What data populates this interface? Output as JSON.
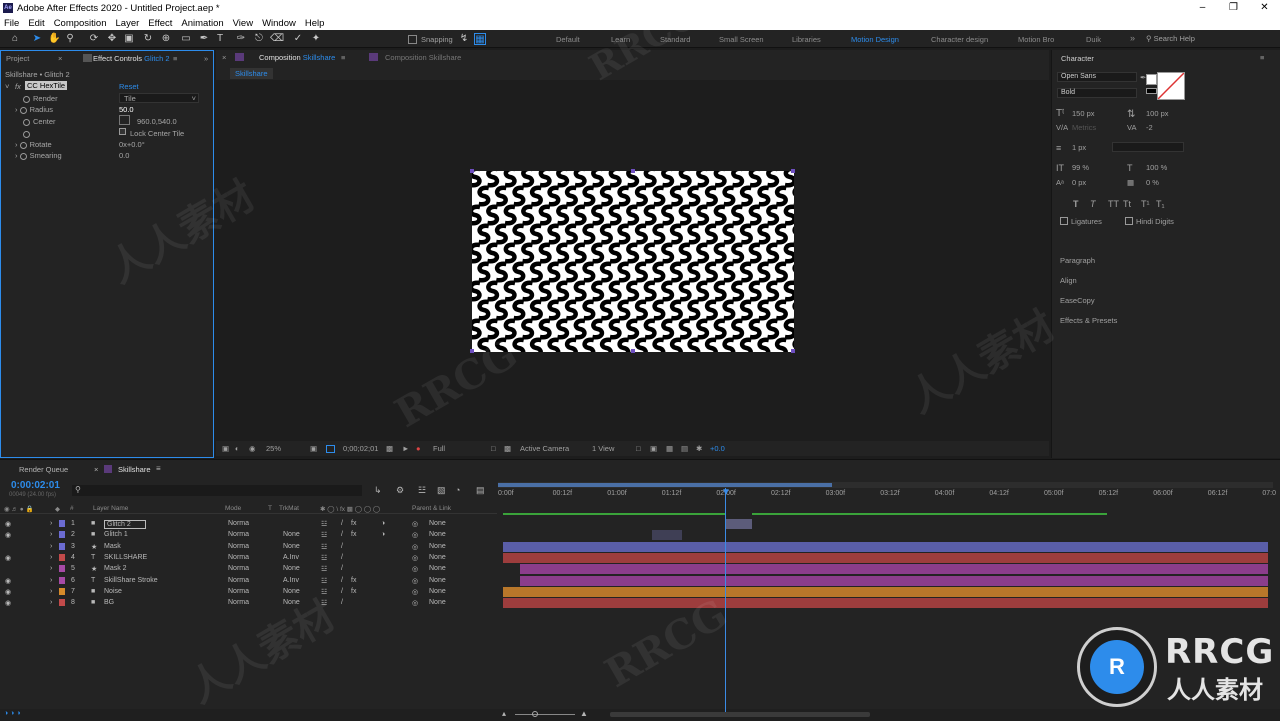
{
  "window": {
    "title": "Adobe After Effects 2020 - Untitled Project.aep *",
    "app_icon": "Ae"
  },
  "menu": [
    "File",
    "Edit",
    "Composition",
    "Layer",
    "Effect",
    "Animation",
    "View",
    "Window",
    "Help"
  ],
  "toolbar": {
    "snapping_label": "Snapping"
  },
  "workspaces": [
    "Default",
    "Learn",
    "Standard",
    "Small Screen",
    "Libraries",
    "Motion Design",
    "Character design",
    "Motion Bro",
    "Duik"
  ],
  "active_workspace": "Motion Design",
  "search_help": "Search Help",
  "effect_controls": {
    "tab_project": "Project",
    "tab_label": "Effect Controls",
    "tab_layer": "Glitch 2",
    "header": "Skillshare • Glitch 2",
    "fx_badge": "fx",
    "effect_name": "CC HexTile",
    "reset": "Reset",
    "props": [
      {
        "name": "Render",
        "value": "Tile"
      },
      {
        "name": "Radius",
        "value": "50.0"
      },
      {
        "name": "Center",
        "value": "960.0,540.0"
      },
      {
        "name": "",
        "value": "Lock Center Tile"
      },
      {
        "name": "Rotate",
        "value": "0x+0.0°"
      },
      {
        "name": "Smearing",
        "value": "0.0"
      }
    ]
  },
  "composition": {
    "tab_prefix": "Composition",
    "tab_name": "Skillshare",
    "tab2": "Composition Skillshare",
    "breadcrumb": "Skillshare"
  },
  "viewer_bar": {
    "zoom": "25%",
    "timecode": "0;00;02;01",
    "resolution": "Full",
    "camera": "Active Camera",
    "views": "1 View",
    "exposure": "+0.0"
  },
  "character": {
    "title": "Character",
    "font": "Open Sans",
    "style": "Bold",
    "size": "150 px",
    "leading": "100 px",
    "kerning": "Metrics",
    "tracking": "-2",
    "stroke": "1 px",
    "v_scale": "99 %",
    "h_scale": "100 %",
    "baseline": "0 px",
    "tsume": "0 %",
    "style_buttons": [
      "T",
      "T",
      "TT",
      "Tt",
      "T¹",
      "T₁"
    ],
    "ligatures": "Ligatures",
    "hindi_digits": "Hindi Digits",
    "sections": [
      "Paragraph",
      "Align",
      "EaseCopy",
      "Effects & Presets"
    ]
  },
  "timeline": {
    "tab_render": "Render Queue",
    "tab_comp": "Skillshare",
    "timecode": "0:00:02:01",
    "frame_info": "00049 (24.00 fps)",
    "col_layer_name": "Layer Name",
    "col_mode": "Mode",
    "col_t": "T",
    "col_trkmat": "TrkMat",
    "col_parent": "Parent & Link",
    "ruler": [
      "0:00f",
      "00:12f",
      "01:00f",
      "01:12f",
      "02:00f",
      "02:12f",
      "03:00f",
      "03:12f",
      "04:00f",
      "04:12f",
      "05:00f",
      "05:12f",
      "06:00f",
      "06:12f",
      "07:0"
    ],
    "playhead_time_fraction": 0.29,
    "layers": [
      {
        "num": "1",
        "name": "Glitch 2",
        "mode": "Norma",
        "trkmat": "",
        "parent": "None",
        "color": "#6b6bd1",
        "type": "solid",
        "bar_color": "#5c5c7a"
      },
      {
        "num": "2",
        "name": "Glitch 1",
        "mode": "Norma",
        "trkmat": "None",
        "parent": "None",
        "color": "#6b6bd1",
        "type": "solid",
        "bar_color": "#3f3f55"
      },
      {
        "num": "3",
        "name": "Mask",
        "mode": "Norma",
        "trkmat": "None",
        "parent": "None",
        "color": "#6b6bd1",
        "type": "shape",
        "bar_color": "#5a5ea8"
      },
      {
        "num": "4",
        "name": "SKILLSHARE",
        "mode": "Norma",
        "trkmat": "A.Inv",
        "parent": "None",
        "color": "#c24a4a",
        "type": "text",
        "bar_color": "#9d3d3d"
      },
      {
        "num": "5",
        "name": "Mask 2",
        "mode": "Norma",
        "trkmat": "None",
        "parent": "None",
        "color": "#a64aa6",
        "type": "shape",
        "bar_color": "#8b3d8b"
      },
      {
        "num": "6",
        "name": "SkillShare Stroke",
        "mode": "Norma",
        "trkmat": "A.Inv",
        "parent": "None",
        "color": "#a64aa6",
        "type": "text",
        "bar_color": "#8b3d8b"
      },
      {
        "num": "7",
        "name": "Noise",
        "mode": "Norma",
        "trkmat": "None",
        "parent": "None",
        "color": "#d68b2a",
        "type": "solid",
        "bar_color": "#b8772a"
      },
      {
        "num": "8",
        "name": "BG",
        "mode": "Norma",
        "trkmat": "None",
        "parent": "None",
        "color": "#c24a4a",
        "type": "solid",
        "bar_color": "#9d3d3d"
      }
    ]
  },
  "watermark": {
    "brand": "RRCG",
    "cn": "人人素材"
  }
}
